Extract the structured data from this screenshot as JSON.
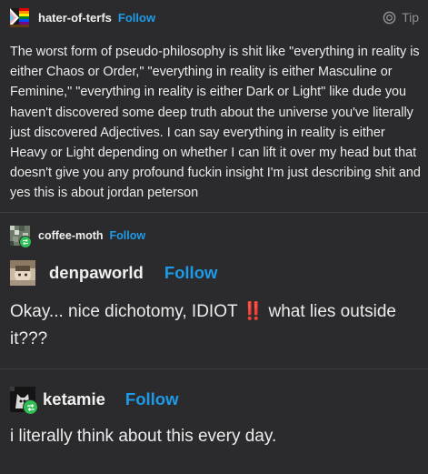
{
  "op": {
    "username": "hater-of-terfs",
    "follow_label": "Follow",
    "tip_label": "Tip",
    "text": "The worst form of pseudo-philosophy is shit like \"everything in reality is either Chaos or Order,\" \"everything in reality is either Masculine or Feminine,\" \"everything in reality is either Dark or Light\" like dude you haven't discovered some deep truth about the universe you've literally just discovered Adjectives. I can say everything in reality is either Heavy or Light depending on whether I can lift it over my head but that doesn't give you any profound fuckin insight I'm just describing shit and yes this is about jordan peterson"
  },
  "reblog1": {
    "username": "coffee-moth",
    "follow_label": "Follow"
  },
  "reply1": {
    "username": "denpaworld",
    "follow_label": "Follow",
    "text_before": "Okay... nice dichotomy, IDIOT",
    "emoji": "‼️",
    "text_after": "what lies outside it???"
  },
  "reply2": {
    "username": "ketamie",
    "follow_label": "Follow",
    "text": "i literally think about this every day."
  },
  "colors": {
    "background": "#2b2b2d",
    "follow_blue": "#1e9be8",
    "reblog_green": "#2fbf55",
    "divider": "#3e3e40"
  }
}
